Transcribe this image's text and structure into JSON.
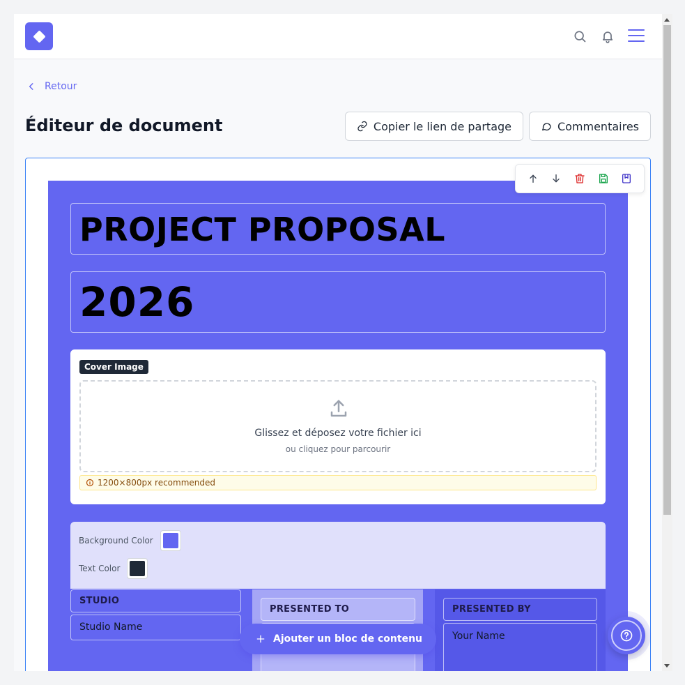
{
  "header": {
    "search_icon": "search-icon",
    "bell_icon": "bell-icon",
    "menu_icon": "hamburger-icon"
  },
  "nav": {
    "back_label": "Retour"
  },
  "page": {
    "title": "Éditeur de document",
    "copy_link_label": "Copier le lien de partage",
    "comments_label": "Commentaires"
  },
  "document": {
    "title": "PROJECT PROPOSAL",
    "year": "2026",
    "cover": {
      "badge": "Cover Image",
      "drop_text": "Glissez et déposez votre fichier ici",
      "browse_text": "ou cliquez pour parcourir",
      "hint": "1200×800px recommended"
    },
    "colors": {
      "background_label": "Background Color",
      "background_value": "#6366f1",
      "text_label": "Text Color",
      "text_value": "#1f2937"
    },
    "columns": [
      {
        "label": "STUDIO",
        "value": "Studio Name"
      },
      {
        "label": "PRESENTED TO",
        "value": ""
      },
      {
        "label": "PRESENTED BY",
        "value": "Your Name"
      }
    ]
  },
  "actions": {
    "add_block_label": "Ajouter un bloc de contenu"
  },
  "colors": {
    "accent": "#6366f1",
    "danger": "#dc2626",
    "success": "#16a34a"
  }
}
